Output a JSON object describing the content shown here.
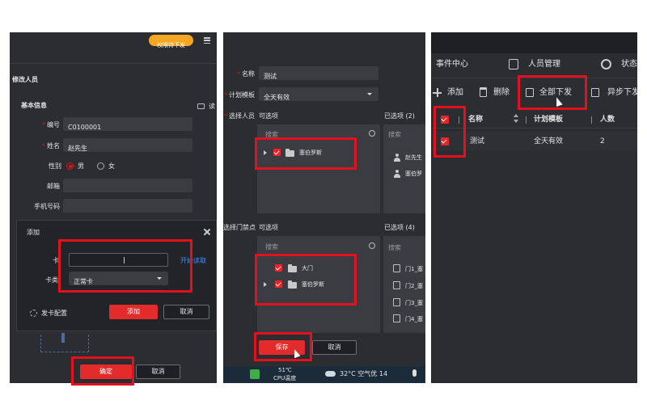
{
  "panel1": {
    "pending_badge": "权限待下发",
    "menu_icon": "list-icon",
    "title": "修改人员",
    "section": "基本信息",
    "read_label": "读",
    "required_mark": "*",
    "fields": {
      "id_label": "编号",
      "id_value": "C0100001",
      "name_label": "姓名",
      "name_value": "赵先生",
      "gender_label": "性别",
      "gender_male": "男",
      "gender_female": "女",
      "email_label": "邮箱",
      "phone_label": "手机号码"
    },
    "dialog": {
      "title": "添加",
      "card_label": "卡",
      "card_type_label": "卡类",
      "card_type_value": "正常卡",
      "read_card_link": "开始读取",
      "card_config": "发卡配置",
      "add_button": "添加",
      "cancel_button": "取消"
    },
    "confirm_button": "确定",
    "cancel_button": "取消"
  },
  "panel2": {
    "required_mark": "*",
    "name_label": "名称",
    "name_value": "测试",
    "template_label": "计划模板",
    "template_value": "全天有效",
    "select_person_label": "选择人员",
    "optional_label": "可选项",
    "selected_persons_label": "已选项 (2)",
    "search_placeholder": "搜索",
    "person_tree": [
      {
        "label": "塞伯罗斯"
      }
    ],
    "selected_persons": [
      "赵先生",
      "塞伯罗"
    ],
    "select_door_label": "选择门禁点",
    "door_optional_label": "可选项",
    "selected_doors_label": "已选项 (4)",
    "door_tree": [
      {
        "label": "大门"
      },
      {
        "label": "塞伯罗斯"
      }
    ],
    "selected_doors": [
      "门1_塞",
      "门2_塞",
      "门3_塞",
      "门4_塞"
    ],
    "save_button": "保存",
    "cancel_button": "取消",
    "taskbar": {
      "cpu_temp": "51℃",
      "cpu_label": "CPU温度",
      "weather": "32°C  空气优 14"
    }
  },
  "panel3": {
    "nav": [
      "事件中心",
      "人员管理",
      "状态"
    ],
    "toolbar": {
      "add": "添加",
      "delete": "删除",
      "download_all": "全部下发",
      "async_download": "异步下发"
    },
    "table": {
      "headers": [
        "名称",
        "计划模板",
        "人数"
      ],
      "rows": [
        {
          "name": "测试",
          "template": "全天有效",
          "count": "2"
        }
      ]
    }
  },
  "colors": {
    "highlight": "#e3111f",
    "badge": "#f5a623",
    "panel_bg": "#2b2d31",
    "primary_button": "#e32b2b"
  }
}
